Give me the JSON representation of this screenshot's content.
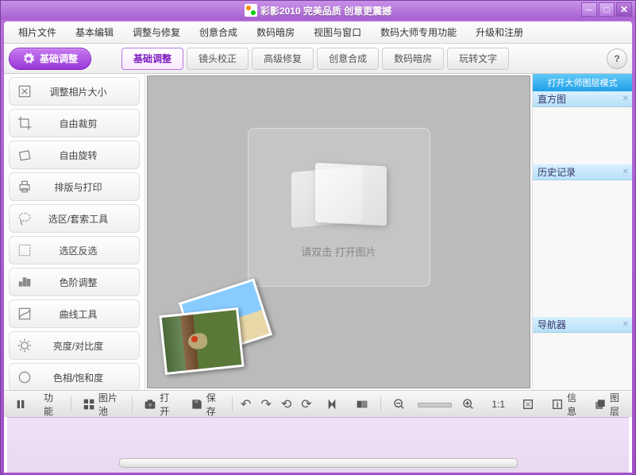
{
  "title": "彩影2010  完美品质  创意更震撼",
  "menu": [
    "相片文件",
    "基本编辑",
    "调整与修复",
    "创意合成",
    "数码暗房",
    "视图与窗口",
    "数码大师专用功能",
    "升级和注册"
  ],
  "mainBtn": "基础调整",
  "tabs": [
    {
      "label": "基础调整",
      "active": true
    },
    {
      "label": "镜头校正",
      "active": false
    },
    {
      "label": "高级修复",
      "active": false
    },
    {
      "label": "创意合成",
      "active": false
    },
    {
      "label": "数码暗房",
      "active": false
    },
    {
      "label": "玩转文字",
      "active": false
    }
  ],
  "help": "?",
  "tools": [
    "调整相片大小",
    "自由裁剪",
    "自由旋转",
    "排版与打印",
    "选区/套索工具",
    "选区反选",
    "色阶调整",
    "曲线工具",
    "亮度/对比度",
    "色相/饱和度"
  ],
  "canvasHint": "请双击 打开图片",
  "rightHeader": "打开大师图层模式",
  "rightSections": [
    "直方图",
    "历史记录",
    "导航器"
  ],
  "status": {
    "func": "功能",
    "pool": "图片池",
    "open": "打开",
    "save": "保存",
    "oneToOne": "1:1",
    "info": "信息",
    "layers": "图层"
  }
}
